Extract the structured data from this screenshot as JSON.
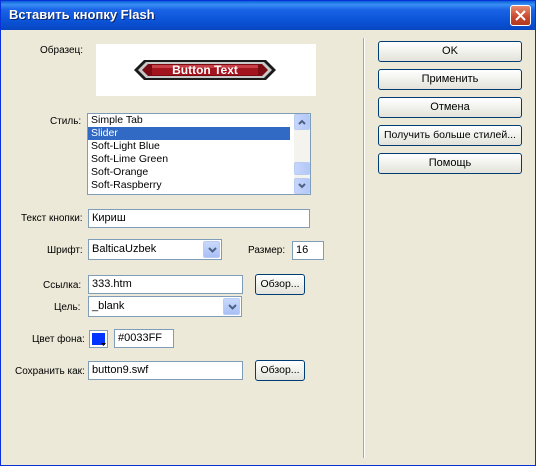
{
  "window": {
    "title": "Вставить кнопку Flash"
  },
  "labels": {
    "sample": "Образец:",
    "style": "Стиль:",
    "button_text": "Текст кнопки:",
    "font": "Шрифт:",
    "size": "Размер:",
    "link": "Ссылка:",
    "target": "Цель:",
    "bg_color": "Цвет фона:",
    "save_as": "Сохранить как:"
  },
  "preview": {
    "button_text": "Button Text"
  },
  "styles": {
    "items": [
      "Simple Tab",
      "Slider",
      "Soft-Light Blue",
      "Soft-Lime Green",
      "Soft-Orange",
      "Soft-Raspberry"
    ],
    "selected": "Slider"
  },
  "fields": {
    "button_text": "Кириш",
    "font": "BalticaUzbek",
    "size": "16",
    "link": "333.htm",
    "target": "_blank",
    "bg_color": "#0033FF",
    "save_as": "button9.swf"
  },
  "buttons": {
    "ok": "OK",
    "apply": "Применить",
    "cancel": "Отмена",
    "more_styles": "Получить больше стилей...",
    "help": "Помощь",
    "browse": "Обзор..."
  },
  "colors": {
    "bg_color_swatch": "#0033FF",
    "selection": "#316ac5"
  }
}
